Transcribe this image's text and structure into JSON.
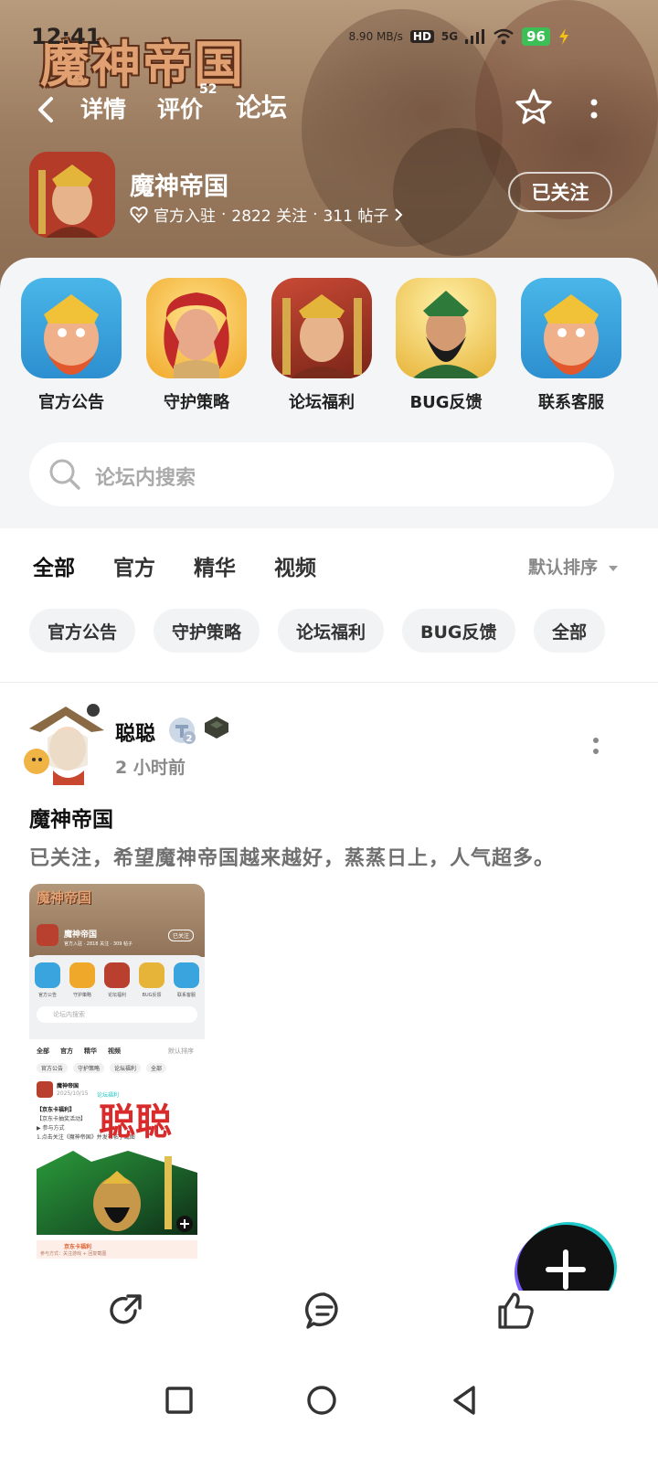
{
  "status_bar": {
    "time": "12:41",
    "speed": "8.90 MB/s",
    "network": "5G",
    "hd": "HD",
    "battery": "96"
  },
  "banner": {
    "logo_text": "魔神帝国"
  },
  "nav": {
    "tabs": [
      {
        "label": "详情"
      },
      {
        "label": "评价"
      },
      {
        "label": "论坛"
      }
    ],
    "review_badge": "52",
    "active_tab": "论坛"
  },
  "app": {
    "title": "魔神帝国",
    "badge": "官方入驻",
    "sep": "·",
    "followers": "2822 关注",
    "posts": "311 帖子",
    "follow_label": "已关注"
  },
  "categories": [
    {
      "label": "官方公告"
    },
    {
      "label": "守护策略"
    },
    {
      "label": "论坛福利"
    },
    {
      "label": "BUG反馈"
    },
    {
      "label": "联系客服"
    }
  ],
  "search": {
    "placeholder": "论坛内搜索"
  },
  "filter_tabs": [
    {
      "label": "全部"
    },
    {
      "label": "官方"
    },
    {
      "label": "精华"
    },
    {
      "label": "视频"
    }
  ],
  "sort_label": "默认排序",
  "chips": [
    {
      "label": "官方公告"
    },
    {
      "label": "守护策略"
    },
    {
      "label": "论坛福利"
    },
    {
      "label": "BUG反馈"
    },
    {
      "label": "全部"
    }
  ],
  "post": {
    "username": "聪聪",
    "level": "2",
    "time": "2 小时前",
    "title": "魔神帝国",
    "body": "已关注，希望魔神帝国越来越好，蒸蒸日上，人气超多。",
    "thumbnail": {
      "logo": "魔神帝国",
      "title": "魔神帝国",
      "follow": "已关注",
      "meta": "官方入驻 · 2818 关注 · 309 帖子",
      "categories": [
        "官方公告",
        "守护策略",
        "论坛福利",
        "BUG反馈",
        "联系客服"
      ],
      "search": "论坛内搜索",
      "tabs": [
        "全部",
        "官方",
        "精华",
        "视频"
      ],
      "sort": "默认排序",
      "chips": [
        "官方公告",
        "守护策略",
        "论坛福利",
        "全部"
      ],
      "post_title": "魔神帝国",
      "post_date": "2025/10/15",
      "post_tag": "论坛福利",
      "lines": [
        "【京东卡福利】",
        "【京东卡抽奖活动】",
        "▶ 参与方式",
        "1.点击关注《魔神帝国》并发布帖子截图"
      ],
      "watermark": "聪聪",
      "footer": "京东卡福利",
      "footer_sub": "参与方式：关注游戏 + 回复截图"
    }
  },
  "colors": {
    "accent": "#22c7c6",
    "fab": "#111111",
    "battery": "#3bbf56"
  }
}
